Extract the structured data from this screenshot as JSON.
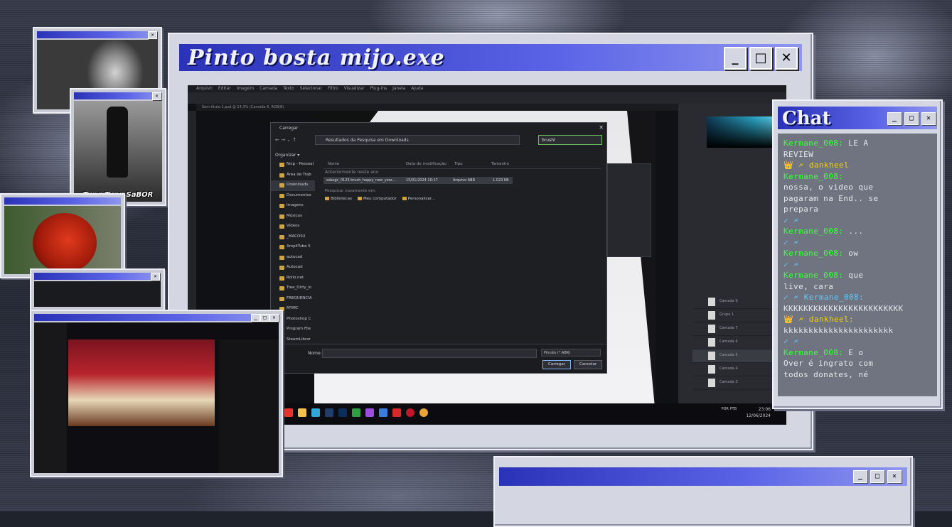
{
  "main_window": {
    "title": "Pinto bosta mijo.exe"
  },
  "photoshop": {
    "menu": [
      "Arquivo",
      "Editar",
      "Imagem",
      "Camada",
      "Texto",
      "Selecionar",
      "Filtro",
      "Visualizar",
      "Plug-ins",
      "Janela",
      "Ajuda"
    ],
    "doc_tab": "Sem título-1.psd @ 14,3% (Camada 6, RGB/8)"
  },
  "open_dialog": {
    "title": "Carregar",
    "path": "Resultados da Pesquisa em Downloads",
    "search_value": "brushl",
    "organize": "Organizar ▾",
    "sidebar": [
      {
        "label": "Nicp - Pessoal"
      },
      {
        "label": "Área de Trab"
      },
      {
        "label": "Downloads"
      },
      {
        "label": "Documentos"
      },
      {
        "label": "Imagens"
      },
      {
        "label": "Músicas"
      },
      {
        "label": "Vídeos"
      },
      {
        "label": "_MACOSX"
      },
      {
        "label": "AmpliTube 5"
      },
      {
        "label": "autocad"
      },
      {
        "label": "Autocad"
      },
      {
        "label": "Rollo.net"
      },
      {
        "label": "Tree_Dirty_In"
      },
      {
        "label": "FREQUENCIA"
      },
      {
        "label": "MYMC"
      },
      {
        "label": "Photoshop C"
      },
      {
        "label": "Program File"
      },
      {
        "label": "SteamLibrar"
      }
    ],
    "columns": {
      "name": "Nome",
      "date": "Data de modificação",
      "type": "Tipo",
      "size": "Tamanho"
    },
    "group": "Anteriormente neste ano",
    "file": {
      "name": "sdasgc_0123 brush_happy_new_year...",
      "date": "15/01/2024 10:17",
      "type": "Arquivo ABR",
      "size": "1.023 KB"
    },
    "search_again": "Pesquisar novamente em:",
    "locations": [
      "Bibliotecas",
      "Meu computador",
      "Personalizar..."
    ],
    "name_label": "Nome:",
    "filter": "Pincéis (*.ABR)",
    "load_btn": "Carregar",
    "cancel_btn": "Cancelar"
  },
  "taskbar": {
    "lang": "POR PTB",
    "time": "23:06",
    "date": "12/06/2024"
  },
  "chat": {
    "title": "Chat",
    "messages": [
      {
        "user": "Kermane_008:",
        "text": " LE A"
      },
      {
        "user": "",
        "text": "REVIEW"
      },
      {
        "user": "👑 🗲 dankheel",
        "text": ""
      },
      {
        "user": "Kermane_008:",
        "text": ""
      },
      {
        "user": "",
        "text": "nossa, o video que"
      },
      {
        "user": "",
        "text": "pagaram na End.. se"
      },
      {
        "user": "",
        "text": "prepara"
      },
      {
        "user": "✓ 🗲",
        "text": ""
      },
      {
        "user": "Kermane_008:",
        "text": " ..."
      },
      {
        "user": "✓ 🗲",
        "text": ""
      },
      {
        "user": "Kermane_008:",
        "text": " ow"
      },
      {
        "user": "✓ 🗲",
        "text": ""
      },
      {
        "user": "Kermane_008:",
        "text": " que"
      },
      {
        "user": "",
        "text": "live, cara"
      },
      {
        "user": "✓ 🗲 Kermane_008:",
        "text": ""
      },
      {
        "user": "",
        "text": "KKKKKKKKKKKKKKKKKKKKKKKK"
      },
      {
        "user": "👑 🗲 dankheel:",
        "text": ""
      },
      {
        "user": "",
        "text": "kkkkkkkkkkkkkkkkkkkkkk"
      },
      {
        "user": "✓ 🗲",
        "text": ""
      },
      {
        "user": "Kermane_008:",
        "text": " E o"
      },
      {
        "user": "",
        "text": "Over é ingrato com"
      },
      {
        "user": "",
        "text": "todos donates, né"
      }
    ]
  },
  "cams": {
    "cam2_caption": "Tung Tung SaBOR"
  },
  "icons": {
    "minimize": "minimize-icon",
    "maximize": "maximize-icon",
    "close": "close-icon"
  },
  "colors": {
    "titlebar": "#2a32b8",
    "chat_user": "#3cff3c",
    "window": "#d4d6e2"
  }
}
